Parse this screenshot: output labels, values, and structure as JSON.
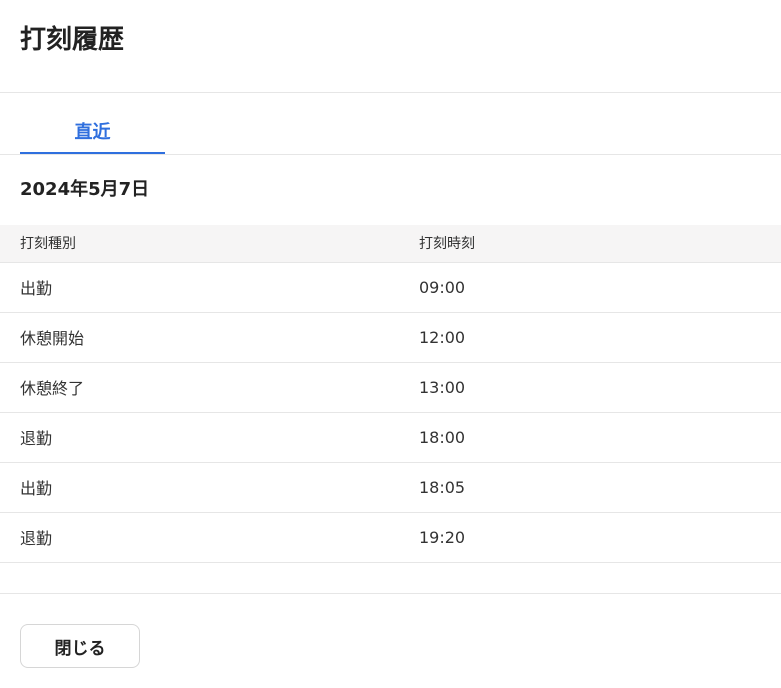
{
  "header": {
    "title": "打刻履歴"
  },
  "tabs": [
    {
      "label": "直近",
      "active": true
    }
  ],
  "date_label": "2024年5月7日",
  "table": {
    "columns": [
      "打刻種別",
      "打刻時刻"
    ],
    "rows": [
      {
        "type": "出勤",
        "time": "09:00"
      },
      {
        "type": "休憩開始",
        "time": "12:00"
      },
      {
        "type": "休憩終了",
        "time": "13:00"
      },
      {
        "type": "退勤",
        "time": "18:00"
      },
      {
        "type": "出勤",
        "time": "18:05"
      },
      {
        "type": "退勤",
        "time": "19:20"
      }
    ]
  },
  "footer": {
    "close_label": "閉じる"
  },
  "colors": {
    "accent": "#2f6fde",
    "header_bg": "#f6f5f5",
    "border": "#e6e6e6"
  }
}
